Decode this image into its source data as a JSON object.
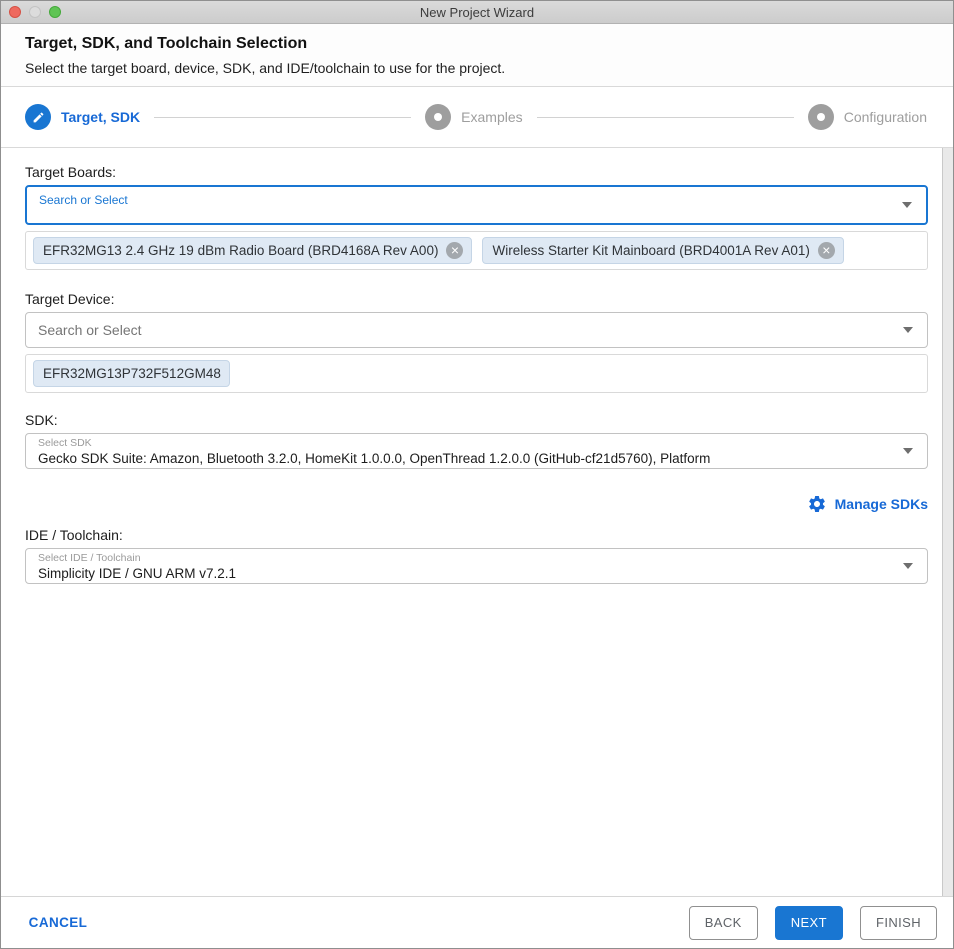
{
  "window": {
    "title": "New Project Wizard"
  },
  "header": {
    "title": "Target, SDK, and Toolchain Selection",
    "subtitle": "Select the target board, device, SDK, and IDE/toolchain to use for the project."
  },
  "stepper": {
    "steps": [
      {
        "label": "Target, SDK",
        "state": "active",
        "icon": "pencil-icon"
      },
      {
        "label": "Examples",
        "state": "upcoming",
        "icon": "dot"
      },
      {
        "label": "Configuration",
        "state": "upcoming",
        "icon": "dot"
      }
    ]
  },
  "form": {
    "target_boards": {
      "label": "Target Boards:",
      "placeholder": "Search or Select",
      "chips": [
        {
          "text": "EFR32MG13 2.4 GHz 19 dBm Radio Board (BRD4168A Rev A00)",
          "removable": true
        },
        {
          "text": "Wireless Starter Kit Mainboard (BRD4001A Rev A01)",
          "removable": true
        }
      ]
    },
    "target_device": {
      "label": "Target Device:",
      "placeholder": "Search or Select",
      "chips": [
        {
          "text": "EFR32MG13P732F512GM48",
          "removable": false
        }
      ]
    },
    "sdk": {
      "label": "SDK:",
      "field_label": "Select SDK",
      "value": "Gecko SDK Suite: Amazon, Bluetooth 3.2.0, HomeKit 1.0.0.0, OpenThread 1.2.0.0 (GitHub-cf21d5760), Platform",
      "manage_link": "Manage SDKs"
    },
    "ide_toolchain": {
      "label": "IDE / Toolchain:",
      "field_label": "Select IDE / Toolchain",
      "value": "Simplicity IDE / GNU ARM v7.2.1"
    }
  },
  "footer": {
    "cancel": "CANCEL",
    "back": "BACK",
    "next": "NEXT",
    "finish": "FINISH"
  },
  "icons": {
    "chip_remove": "×",
    "manage": "gear",
    "dropdown": "caret-down",
    "step_edit": "pencil"
  },
  "colors": {
    "accent": "#1976d2",
    "link_blue": "#1769d6",
    "step_inactive": "#9e9e9e",
    "chip_bg": "#dfe9f4",
    "traffic_close": "#ee6a5f",
    "traffic_min_disabled": "#dcdcdc",
    "traffic_zoom": "#5fc454"
  }
}
